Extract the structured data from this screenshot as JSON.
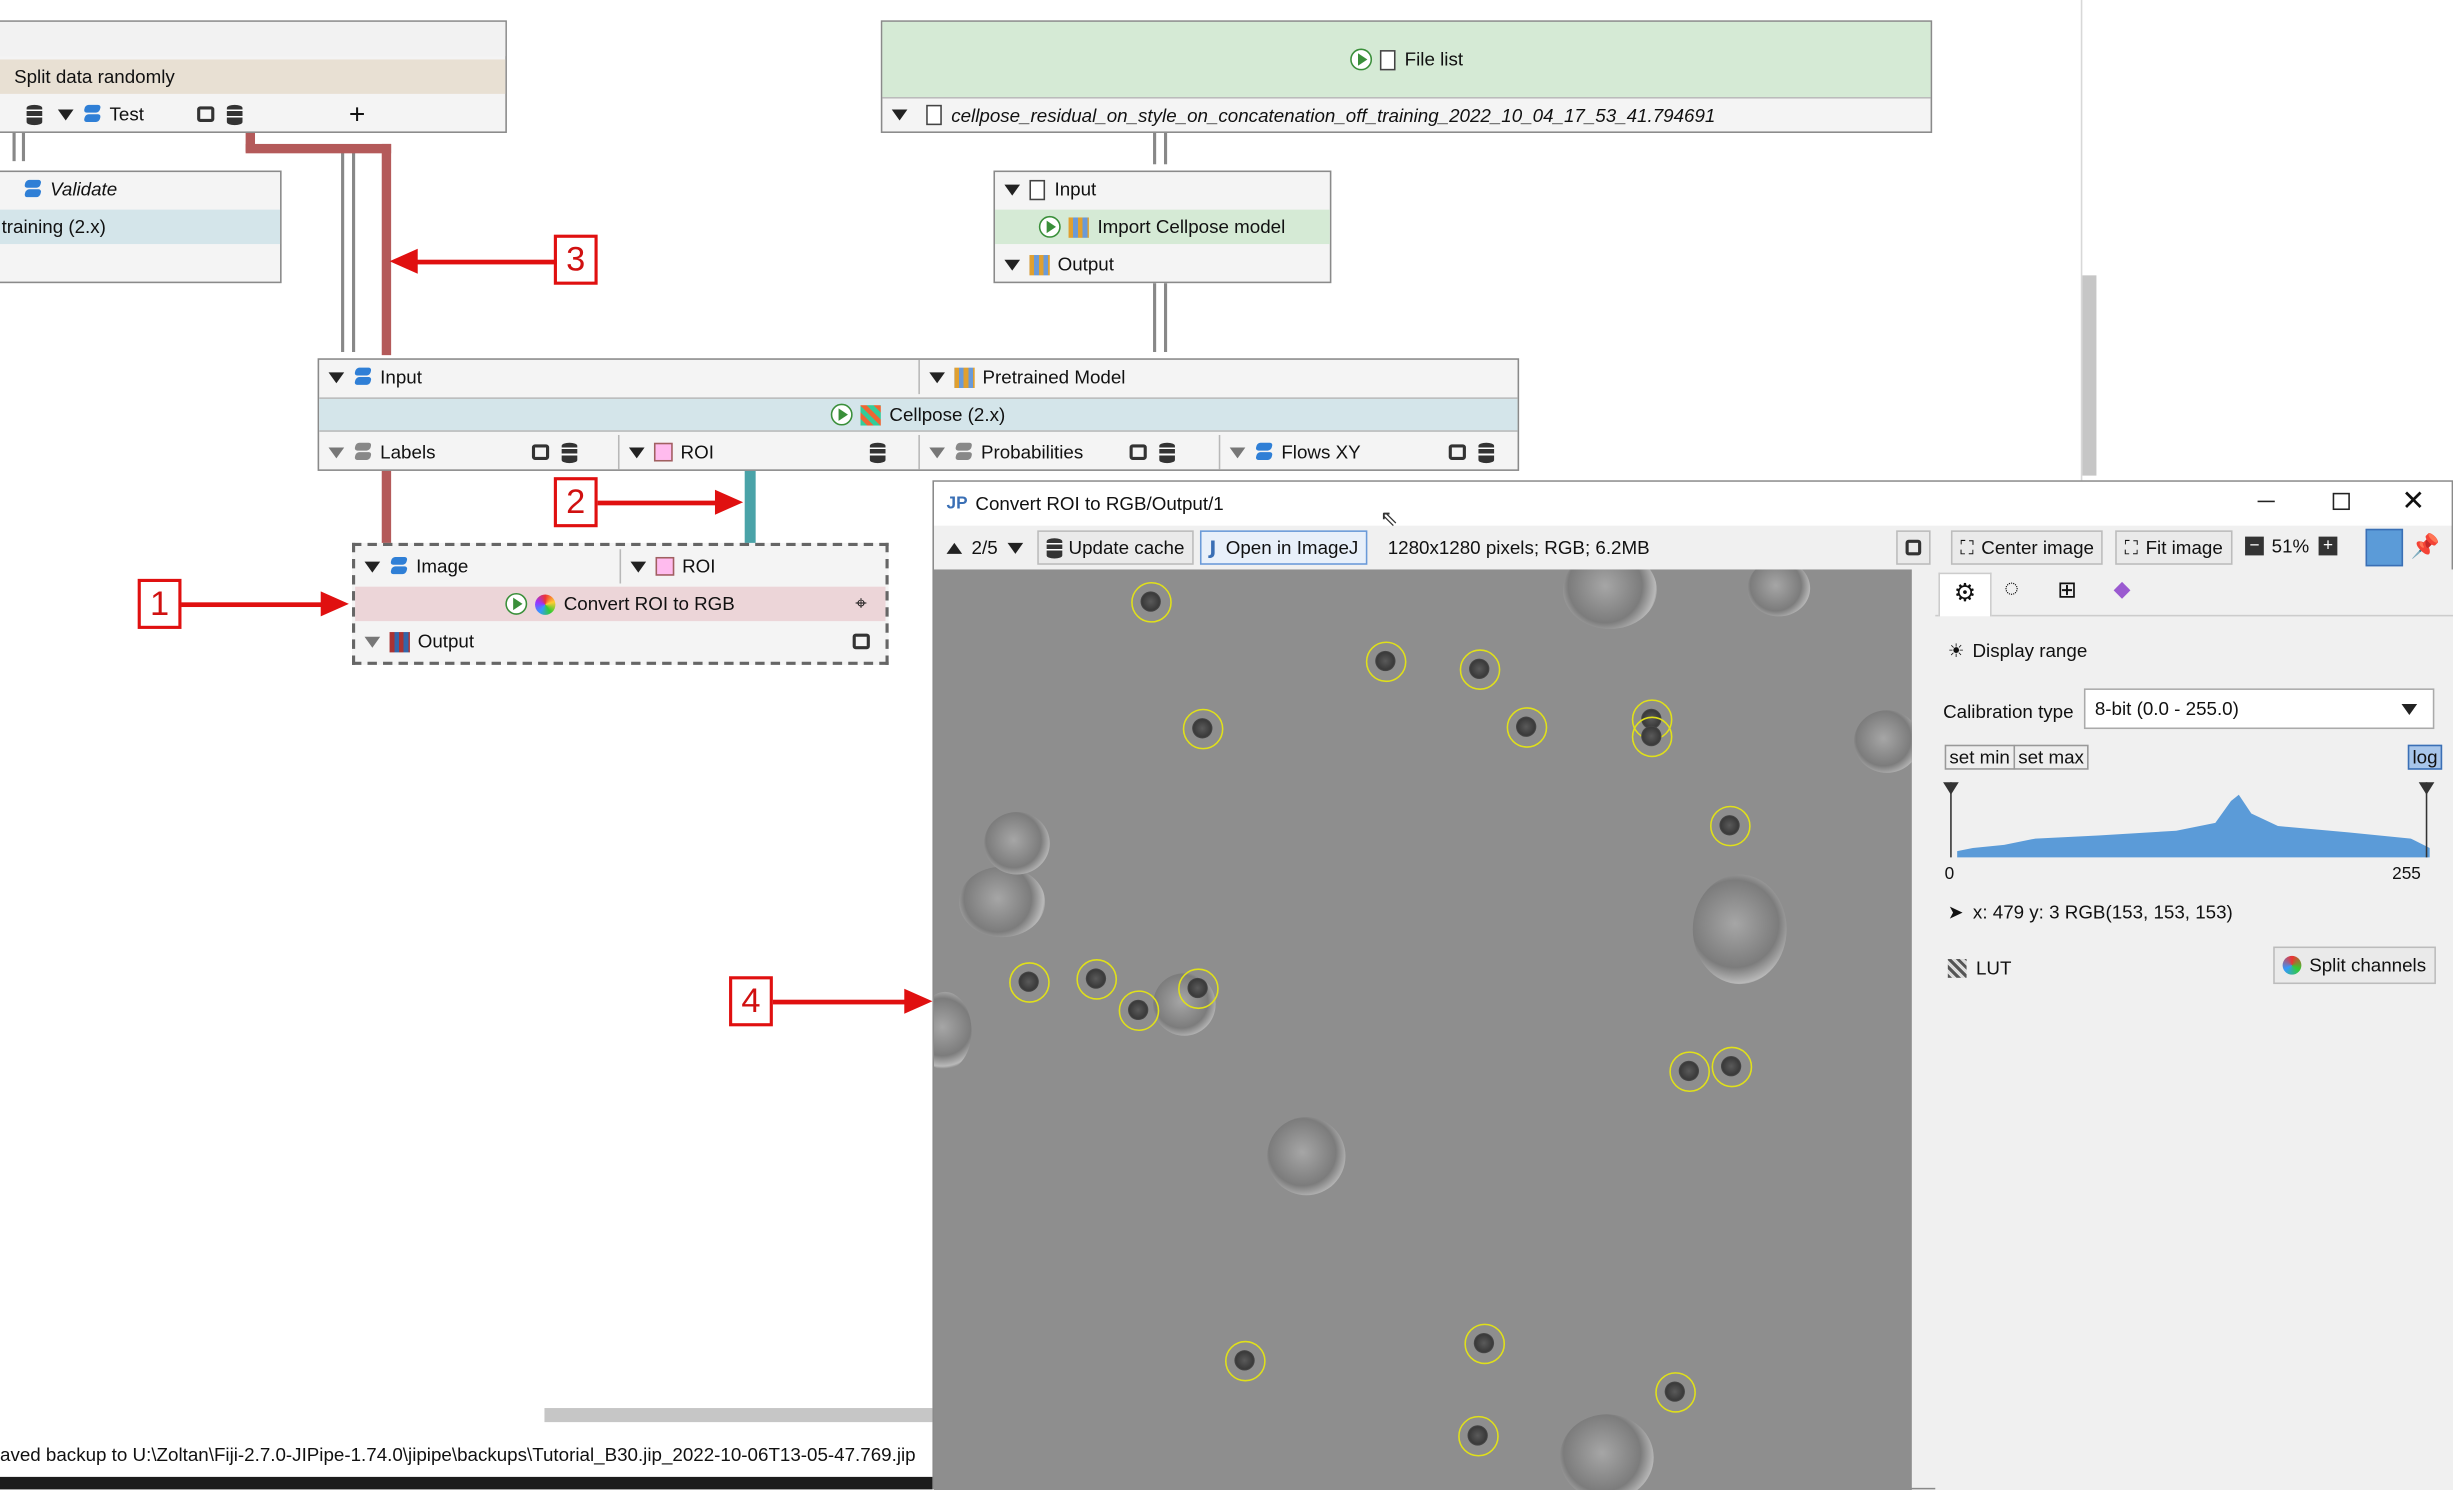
{
  "graph": {
    "split_node": {
      "title": "Split data randomly",
      "out_test": "Test",
      "add": "+"
    },
    "validate_node": {
      "slot": "Validate",
      "title": "training (2.x)"
    },
    "filelist_node": {
      "title": "File list",
      "path": "cellpose_residual_on_style_on_concatenation_off_training_2022_10_04_17_53_41.794691"
    },
    "import_node": {
      "input": "Input",
      "title": "Import Cellpose model",
      "output": "Output"
    },
    "cellpose_node": {
      "in_input": "Input",
      "in_model": "Pretrained Model",
      "title": "Cellpose (2.x)",
      "out_labels": "Labels",
      "out_roi": "ROI",
      "out_prob": "Probabilities",
      "out_flows": "Flows XY"
    },
    "convert_node": {
      "in_image": "Image",
      "in_roi": "ROI",
      "title": "Convert ROI to RGB",
      "output": "Output"
    }
  },
  "callouts": [
    "1",
    "2",
    "3",
    "4"
  ],
  "status_bar": {
    "text": "aved backup to U:\\Zoltan\\Fiji-2.7.0-JIPipe-1.74.0\\jipipe\\backups\\Tutorial_B30.jip_2022-10-06T13-05-47.769.jip"
  },
  "viewer": {
    "window_title": "Convert ROI to RGB/Output/1",
    "page_indicator": "2/5",
    "update_cache": "Update cache",
    "open_in_imagej": "Open in ImageJ",
    "image_info": "1280x1280 pixels; RGB; 6.2MB",
    "center_image": "Center image",
    "fit_image": "Fit image",
    "zoom": "51%",
    "display_range": "Display range",
    "calibration_label": "Calibration type",
    "calibration_value": "8-bit (0.0 - 255.0)",
    "set_min": "set min",
    "set_max": "set max",
    "log": "log",
    "hist_min": "0",
    "hist_max": "255",
    "pixel_info": "x: 479 y: 3 RGB(153, 153, 153)",
    "lut": "LUT",
    "split_channels": "Split channels"
  },
  "colors": {
    "accent_red": "#e01010",
    "pipe_red": "#b45a5a",
    "pipe_teal": "#4aa3a8",
    "roi_yellow": "#e0e01a",
    "histogram_blue": "#5b9bd8"
  }
}
